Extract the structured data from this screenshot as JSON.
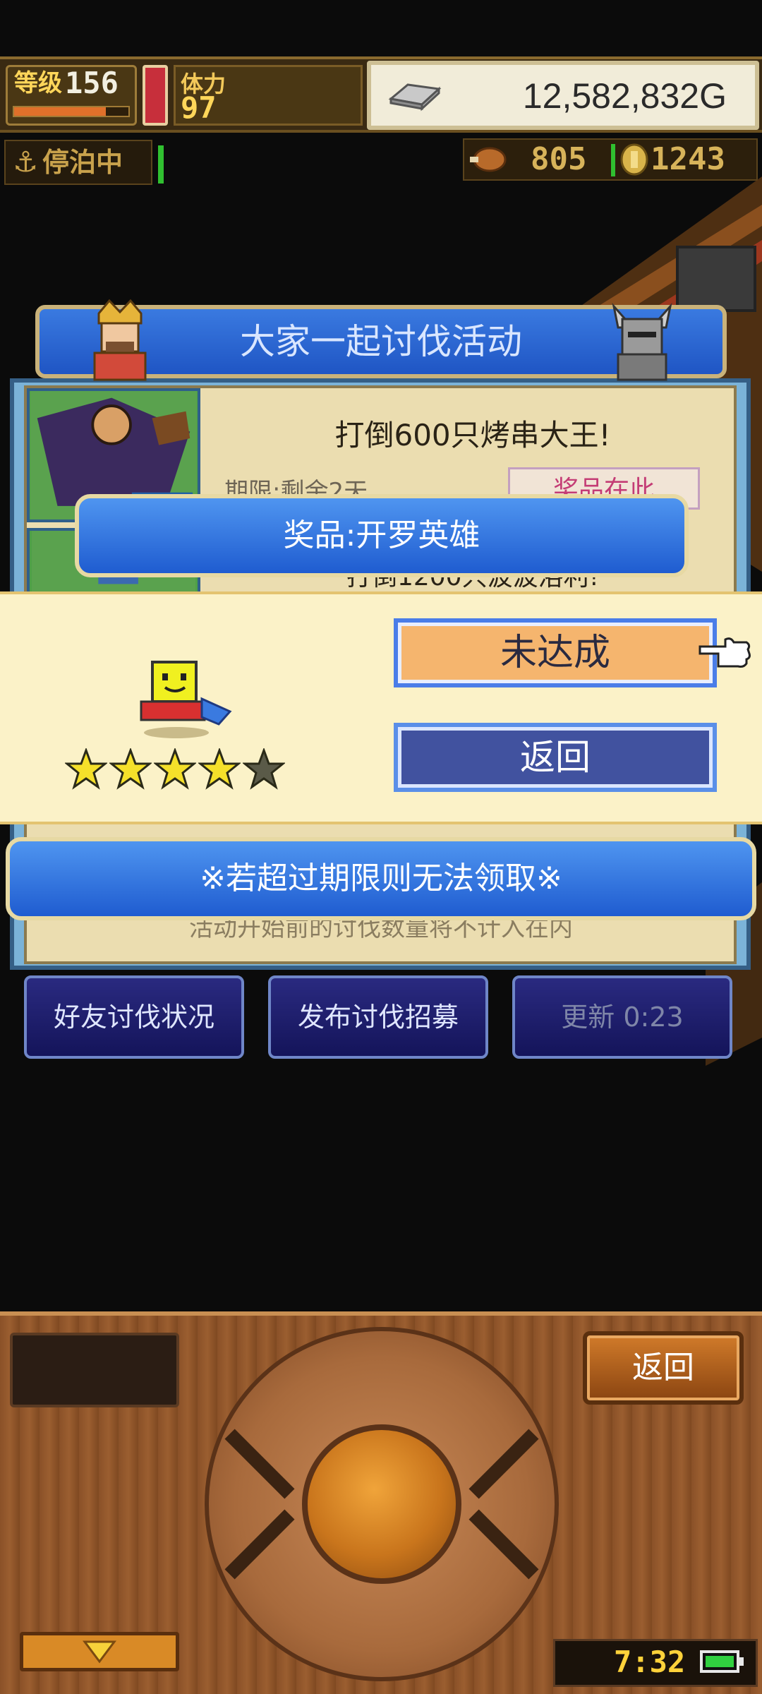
{
  "hud": {
    "level_label": "等级",
    "level_value": "156",
    "exp_fraction": 0.8,
    "stamina_label": "体力",
    "stamina_value": "97",
    "gold": "12,582,832G",
    "moored_icon": "⚓",
    "moored_label": "停泊中",
    "food": "805",
    "coins": "1243"
  },
  "event": {
    "title": "大家一起讨伐活动",
    "mission": "打倒600只烤串大王!",
    "deadline": "期限:剩余2天",
    "reward_tag": "奖品在此",
    "mission2": "打倒1200只波波洛利!",
    "note": "活动开始前的讨伐数量将不计入在内",
    "buttons": [
      "好友讨伐状况",
      "发布讨伐招募",
      "更新 0:23"
    ]
  },
  "popup": {
    "prize_title": "奖品:开罗英雄",
    "stars_total": 5,
    "stars_filled": 4,
    "status_label": "未达成",
    "back_label": "返回",
    "warning": "※若超过期限则无法领取※"
  },
  "controller": {
    "return_label": "返回",
    "clock": "7:32"
  },
  "colors": {
    "banner_blue": "#2a6ad8",
    "status_orange": "#f5b56e",
    "back_navy": "#41529f",
    "panel_cream": "#fbf2c8",
    "gold_text": "#ffd23a"
  }
}
